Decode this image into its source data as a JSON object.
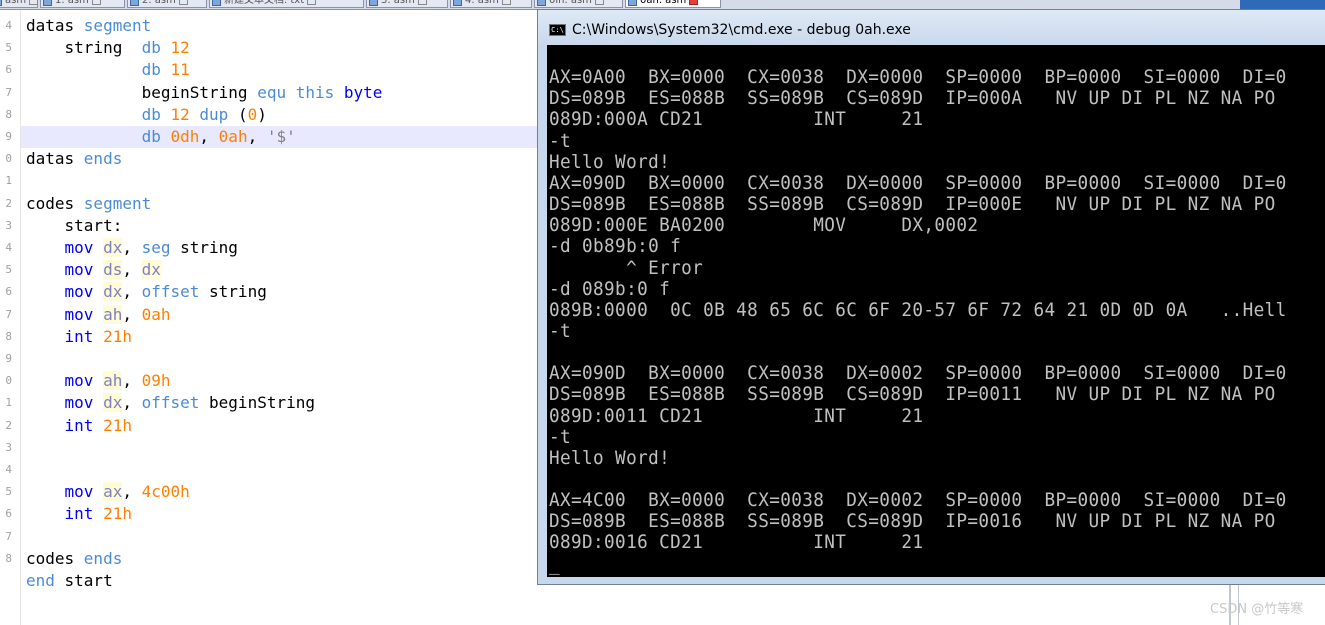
{
  "tabs": [
    {
      "label": "asm",
      "active": false
    },
    {
      "label": "1. asm",
      "active": false
    },
    {
      "label": "2. asm",
      "active": false
    },
    {
      "label": "新建文本文档. txt",
      "active": false
    },
    {
      "label": "3. asm",
      "active": false
    },
    {
      "label": "4. asm",
      "active": false
    },
    {
      "label": "0ih. asm",
      "active": false
    },
    {
      "label": "0ah. asm",
      "active": true
    }
  ],
  "editor": {
    "line_numbers": [
      "4",
      "5",
      "6",
      "7",
      "8",
      "9",
      "0",
      "1",
      "2",
      "3",
      "4",
      "5",
      "6",
      "7",
      "8",
      "9",
      "0",
      "1",
      "2",
      "3",
      "4",
      "5",
      "6",
      "7",
      "8"
    ],
    "lines": [
      [
        {
          "t": "datas ",
          "c": "plain"
        },
        {
          "t": "segment",
          "c": "seg"
        }
      ],
      [
        {
          "t": "    string  ",
          "c": "plain"
        },
        {
          "t": "db ",
          "c": "seg"
        },
        {
          "t": "12",
          "c": "num"
        }
      ],
      [
        {
          "t": "            ",
          "c": "plain"
        },
        {
          "t": "db ",
          "c": "seg"
        },
        {
          "t": "11",
          "c": "num"
        }
      ],
      [
        {
          "t": "            beginString ",
          "c": "plain"
        },
        {
          "t": "equ ",
          "c": "seg"
        },
        {
          "t": "this ",
          "c": "seg"
        },
        {
          "t": "byte",
          "c": "kw"
        }
      ],
      [
        {
          "t": "            ",
          "c": "plain"
        },
        {
          "t": "db ",
          "c": "seg"
        },
        {
          "t": "12 ",
          "c": "num"
        },
        {
          "t": "dup ",
          "c": "seg"
        },
        {
          "t": "(",
          "c": "plain"
        },
        {
          "t": "0",
          "c": "num"
        },
        {
          "t": ")",
          "c": "plain"
        }
      ],
      [
        {
          "t": "            ",
          "c": "plain"
        },
        {
          "t": "db ",
          "c": "seg"
        },
        {
          "t": "0dh",
          "c": "num"
        },
        {
          "t": ", ",
          "c": "plain"
        },
        {
          "t": "0ah",
          "c": "num"
        },
        {
          "t": ", ",
          "c": "plain"
        },
        {
          "t": "'$'",
          "c": "str"
        }
      ],
      [
        {
          "t": "datas ",
          "c": "plain"
        },
        {
          "t": "ends",
          "c": "seg"
        }
      ],
      [],
      [
        {
          "t": "codes ",
          "c": "plain"
        },
        {
          "t": "segment",
          "c": "seg"
        }
      ],
      [
        {
          "t": "    start:",
          "c": "plain"
        }
      ],
      [
        {
          "t": "    ",
          "c": "plain"
        },
        {
          "t": "mov ",
          "c": "kw"
        },
        {
          "t": "dx",
          "c": "reg"
        },
        {
          "t": ", ",
          "c": "plain"
        },
        {
          "t": "seg ",
          "c": "seg"
        },
        {
          "t": "string",
          "c": "plain"
        }
      ],
      [
        {
          "t": "    ",
          "c": "plain"
        },
        {
          "t": "mov ",
          "c": "kw"
        },
        {
          "t": "ds",
          "c": "reg"
        },
        {
          "t": ", ",
          "c": "plain"
        },
        {
          "t": "dx",
          "c": "reg"
        }
      ],
      [
        {
          "t": "    ",
          "c": "plain"
        },
        {
          "t": "mov ",
          "c": "kw"
        },
        {
          "t": "dx",
          "c": "reg"
        },
        {
          "t": ", ",
          "c": "plain"
        },
        {
          "t": "offset ",
          "c": "seg"
        },
        {
          "t": "string",
          "c": "plain"
        }
      ],
      [
        {
          "t": "    ",
          "c": "plain"
        },
        {
          "t": "mov ",
          "c": "kw"
        },
        {
          "t": "ah",
          "c": "reg"
        },
        {
          "t": ", ",
          "c": "plain"
        },
        {
          "t": "0ah",
          "c": "num"
        }
      ],
      [
        {
          "t": "    ",
          "c": "plain"
        },
        {
          "t": "int ",
          "c": "kw"
        },
        {
          "t": "21h",
          "c": "num"
        }
      ],
      [],
      [
        {
          "t": "    ",
          "c": "plain"
        },
        {
          "t": "mov ",
          "c": "kw"
        },
        {
          "t": "ah",
          "c": "reg"
        },
        {
          "t": ", ",
          "c": "plain"
        },
        {
          "t": "09h",
          "c": "num"
        }
      ],
      [
        {
          "t": "    ",
          "c": "plain"
        },
        {
          "t": "mov ",
          "c": "kw"
        },
        {
          "t": "dx",
          "c": "reg"
        },
        {
          "t": ", ",
          "c": "plain"
        },
        {
          "t": "offset ",
          "c": "seg"
        },
        {
          "t": "beginString",
          "c": "plain"
        }
      ],
      [
        {
          "t": "    ",
          "c": "plain"
        },
        {
          "t": "int ",
          "c": "kw"
        },
        {
          "t": "21h",
          "c": "num"
        }
      ],
      [],
      [],
      [
        {
          "t": "    ",
          "c": "plain"
        },
        {
          "t": "mov ",
          "c": "kw"
        },
        {
          "t": "ax",
          "c": "reg"
        },
        {
          "t": ", ",
          "c": "plain"
        },
        {
          "t": "4c00h",
          "c": "num"
        }
      ],
      [
        {
          "t": "    ",
          "c": "plain"
        },
        {
          "t": "int ",
          "c": "kw"
        },
        {
          "t": "21h",
          "c": "num"
        }
      ],
      [],
      [
        {
          "t": "codes ",
          "c": "plain"
        },
        {
          "t": "ends",
          "c": "seg"
        }
      ],
      [
        {
          "t": "end ",
          "c": "seg"
        },
        {
          "t": "start",
          "c": "plain"
        }
      ]
    ],
    "current_line_index": 5
  },
  "cmd": {
    "title": "C:\\Windows\\System32\\cmd.exe - debug  0ah.exe",
    "icon_label": "C:\\",
    "lines": [
      "",
      "AX=0A00  BX=0000  CX=0038  DX=0000  SP=0000  BP=0000  SI=0000  DI=0",
      "DS=089B  ES=088B  SS=089B  CS=089D  IP=000A   NV UP DI PL NZ NA PO",
      "089D:000A CD21          INT     21",
      "-t",
      "Hello Word!",
      "AX=090D  BX=0000  CX=0038  DX=0000  SP=0000  BP=0000  SI=0000  DI=0",
      "DS=089B  ES=088B  SS=089B  CS=089D  IP=000E   NV UP DI PL NZ NA PO",
      "089D:000E BA0200        MOV     DX,0002",
      "-d 0b89b:0 f",
      "       ^ Error",
      "-d 089b:0 f",
      "089B:0000  0C 0B 48 65 6C 6C 6F 20-57 6F 72 64 21 0D 0D 0A   ..Hell",
      "-t",
      "",
      "AX=090D  BX=0000  CX=0038  DX=0002  SP=0000  BP=0000  SI=0000  DI=0",
      "DS=089B  ES=088B  SS=089B  CS=089D  IP=0011   NV UP DI PL NZ NA PO",
      "089D:0011 CD21          INT     21",
      "-t",
      "Hello Word!",
      "",
      "AX=4C00  BX=0000  CX=0038  DX=0002  SP=0000  BP=0000  SI=0000  DI=0",
      "DS=089B  ES=088B  SS=089B  CS=089D  IP=0016   NV UP DI PL NZ NA PO",
      "089D:0016 CD21          INT     21",
      "_"
    ]
  },
  "watermark": "CSDN @竹等寒",
  "colors": {
    "keyword": "#0000ff",
    "directive": "#4a8bd8",
    "number": "#ff8000",
    "string": "#808080",
    "register": "#8080c0",
    "current_line_bg": "#e8e8ff",
    "console_bg": "#000000",
    "console_fg": "#c0c0c0"
  }
}
